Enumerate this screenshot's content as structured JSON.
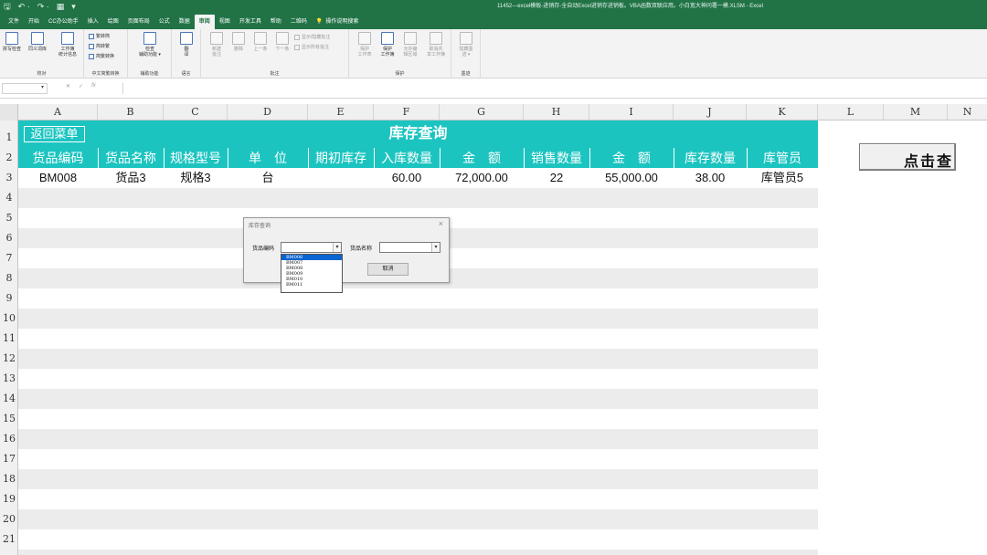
{
  "titlebar": {
    "qat": [
      "🖫",
      "↶ ·",
      "↷ ·",
      "▦",
      "▾"
    ],
    "window_title": "11452---excel模板-进销存-全自动Excel进销存进销板。VBA函数双联应用。小白宽大神问署一模.XLSM  -  Excel"
  },
  "menu": {
    "tabs": [
      "文件",
      "开始",
      "CC办公助手",
      "插入",
      "绘图",
      "页面布局",
      "公式",
      "数据",
      "审阅",
      "视图",
      "开发工具",
      "帮助",
      "二维码"
    ],
    "active": "审阅",
    "tell_icon": "lightbulb-icon",
    "tell_label": "操作说明搜索"
  },
  "ribbon": {
    "g1": {
      "label": "校对",
      "buttons": [
        "拼写检查",
        "同义词库",
        "工作簿\n统计信息"
      ]
    },
    "g2": {
      "label": "中文简繁转换",
      "items": [
        "繁转简",
        "简转繁",
        "简繁转换"
      ]
    },
    "g3": {
      "label": "辅助功能",
      "button": "检查\n辅助功能 ▾"
    },
    "g4": {
      "label": "语言",
      "button": "翻\n译"
    },
    "g5": {
      "label": "批注",
      "buttons": [
        "新建\n批注",
        "删除",
        "上一条",
        "下一条"
      ],
      "items": [
        "显示/隐藏批注",
        "显示所有批注"
      ]
    },
    "g6": {
      "label": "保护",
      "buttons": [
        "保护\n工作表",
        "保护\n工作簿",
        "允许编\n辑区域",
        "取消共\n享工作簿"
      ]
    },
    "g7": {
      "label": "墨迹",
      "button": "隐藏墨\n迹 ▾"
    }
  },
  "formula_bar": {
    "name_box": "▾",
    "cancel": "✕",
    "enter": "✓",
    "fx": "fx",
    "value": ""
  },
  "columns": [
    "A",
    "B",
    "C",
    "D",
    "E",
    "F",
    "G",
    "H",
    "I",
    "J",
    "K",
    "L",
    "M",
    "N"
  ],
  "rows": [
    "1",
    "2",
    "3",
    "4",
    "5",
    "6",
    "7",
    "8",
    "9",
    "10",
    "11",
    "12",
    "13",
    "14",
    "15",
    "16",
    "17",
    "18",
    "19",
    "20",
    "21"
  ],
  "sheet": {
    "back_button": "返回菜单",
    "title": "库存查询",
    "headers": [
      "货品编码",
      "货品名称",
      "规格型号",
      "单　位",
      "期初库存",
      "入库数量",
      "金　额",
      "销售数量",
      "金　额",
      "库存数量",
      "库管员"
    ],
    "row3": [
      "BM008",
      "货品3",
      "规格3",
      "台",
      "",
      "60.00",
      "72,000.00",
      "22",
      "55,000.00",
      "38.00",
      "库管员5"
    ],
    "side_button": "点击查"
  },
  "dialog": {
    "title": "库存查询",
    "close": "×",
    "code_label": "货品编码",
    "name_label": "货品名称",
    "cancel_button": "取消",
    "code_value": "",
    "name_value": "",
    "dropdown_options": [
      "BM006",
      "BM007",
      "BM008",
      "BM009",
      "BM010",
      "BM011"
    ],
    "selected_option": "BM006"
  },
  "colors": {
    "excel_green": "#217346",
    "teal": "#1cc4c0",
    "band": "#ececec",
    "select_blue": "#0a64d2"
  }
}
